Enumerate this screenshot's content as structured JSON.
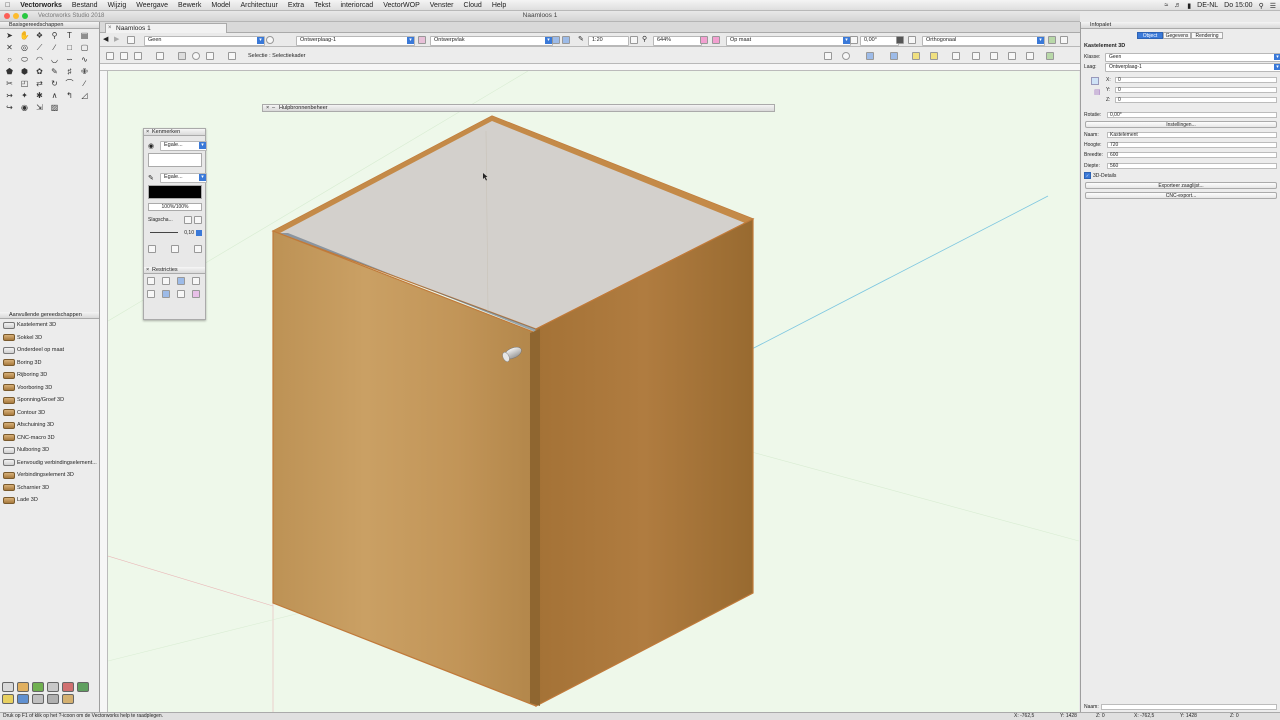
{
  "menubar": {
    "app": "Vectorworks",
    "items": [
      "Bestand",
      "Wijzig",
      "Weergave",
      "Bewerk",
      "Model",
      "Architectuur",
      "Extra",
      "Tekst",
      "interiorcad",
      "VectorWOP",
      "Venster",
      "Cloud",
      "Help"
    ],
    "clock": "Do 15:00",
    "locale": "DE-NL"
  },
  "window": {
    "title": "Naamloos 1",
    "subtitle": "Vectorworks Studio 2018",
    "doc_tab": "Naamloos 1"
  },
  "viewbar": {
    "class": "Geen",
    "layer": "Ontwerplaag-1",
    "plane": "Ontwerpvlak",
    "scale": "1:20",
    "zoom": "644%",
    "units": "Op maat",
    "angle": "0,00°",
    "projection": "Orthogonaal"
  },
  "toolbar": {
    "mode_text": "Selectie : Selectiekader"
  },
  "left_panel": {
    "basic_tools_title": "Basisgereedschappen",
    "extra_tools_title": "Aanvullende gereedschappen",
    "extra_tools": [
      "Kastelement 3D",
      "Sokkel 3D",
      "Onderdeel op maat",
      "Boring 3D",
      "Rijboring 3D",
      "Voorboring 3D",
      "Sponning/Groef 3D",
      "Contour 3D",
      "Afschuining 3D",
      "CNC-macro 3D",
      "Nulboring 3D",
      "Eenvoudig verbindingselement...",
      "Verbindingselement 3D",
      "Scharnier 3D",
      "Lade 3D"
    ]
  },
  "attributes_palette": {
    "title": "Kenmerken",
    "fill_label": "Egale...",
    "pen_label": "Egale...",
    "opacity": "100%/100%",
    "shadow_label": "Slagscha...",
    "line_weight": "0,10",
    "constraints_title": "Restricties"
  },
  "resource_manager": {
    "title": "Hulpbronnenbeheer"
  },
  "info_palette": {
    "title": "Infopalet",
    "tabs": [
      "Object",
      "Gegevens",
      "Rendering"
    ],
    "object_type": "Kastelement 3D",
    "class_label": "Klasse:",
    "class_value": "Geen",
    "layer_label": "Laag:",
    "layer_value": "Ontwerplaag-1",
    "x_label": "X:",
    "x_value": "0",
    "y_label": "Y:",
    "y_value": "0",
    "z_label": "Z:",
    "z_value": "0",
    "rotation_label": "Rotatie:",
    "rotation_value": "0,00°",
    "settings_button": "Instellingen...",
    "name_label": "Naam:",
    "name_value": "Kastelement",
    "height_label": "Hoogte:",
    "height_value": "720",
    "width_label": "Breedte:",
    "width_value": "600",
    "depth_label": "Diepte:",
    "depth_value": "560",
    "details_checkbox": "3D-Details",
    "export_button": "Exporteer zaaglijst...",
    "cnc_button": "CNC-export...",
    "footer_name_label": "Naam:"
  },
  "statusbar": {
    "hint": "Druk op F1 of klik op het ?-icoon om de Vectorworks help te raadplegen.",
    "x1": "X: -762,5",
    "y1": "Y: 1428",
    "z1": "Z: 0",
    "x2": "X: -762,5",
    "y2": "Y: 1428",
    "z2": "Z: 0"
  },
  "colors": {
    "accent": "#3a79d8",
    "canvas": "#eef8ea",
    "wood_light": "#c8a063",
    "wood_dark": "#a8783e",
    "top_panel": "#d3d0cc"
  }
}
